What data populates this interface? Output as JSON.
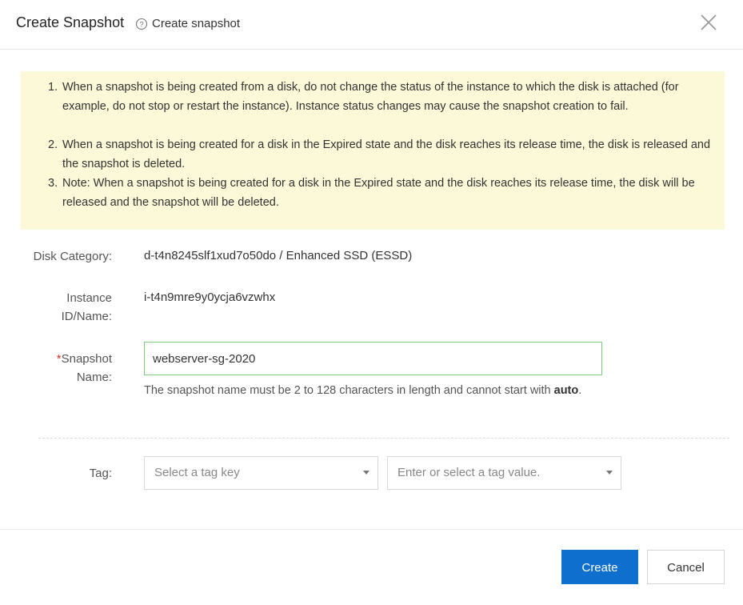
{
  "header": {
    "title": "Create Snapshot",
    "subtitle": "Create snapshot",
    "help_icon": "question-circle-icon",
    "close_icon": "close-icon"
  },
  "notice": {
    "items": [
      {
        "num": "1.",
        "text": "When a snapshot is being created from a disk, do not change the status of the instance to which the disk is attached (for example, do not stop or restart the instance). Instance status changes may cause the snapshot creation to fail."
      },
      {
        "num": "2.",
        "text": "When a snapshot is being created for a disk in the Expired state and the disk reaches its release time, the disk is released and the snapshot is deleted."
      },
      {
        "num": "3.",
        "text": "Note: When a snapshot is being created for a disk in the Expired state and the disk reaches its release time, the disk will be released and the snapshot will be deleted."
      }
    ]
  },
  "form": {
    "disk_category": {
      "label": "Disk Category:",
      "value": "d-t4n8245slf1xud7o50do / Enhanced SSD (ESSD)"
    },
    "instance": {
      "label": "Instance ID/Name:",
      "value": "i-t4n9mre9y0ycja6vzwhx"
    },
    "snapshot_name": {
      "required_mark": "*",
      "label": "Snapshot Name:",
      "value": "webserver-sg-2020",
      "hint_prefix": "The snapshot name must be 2 to 128 characters in length and cannot start with ",
      "hint_bold": "auto",
      "hint_suffix": "."
    },
    "tag": {
      "label": "Tag:",
      "key_placeholder": "Select a tag key",
      "value_placeholder": "Enter or select a tag value."
    }
  },
  "footer": {
    "create_label": "Create",
    "cancel_label": "Cancel"
  },
  "colors": {
    "primary": "#0f6fcf",
    "notice_bg": "#fcf9d8",
    "input_focus_border": "#7ac97d",
    "required": "#d93026"
  }
}
